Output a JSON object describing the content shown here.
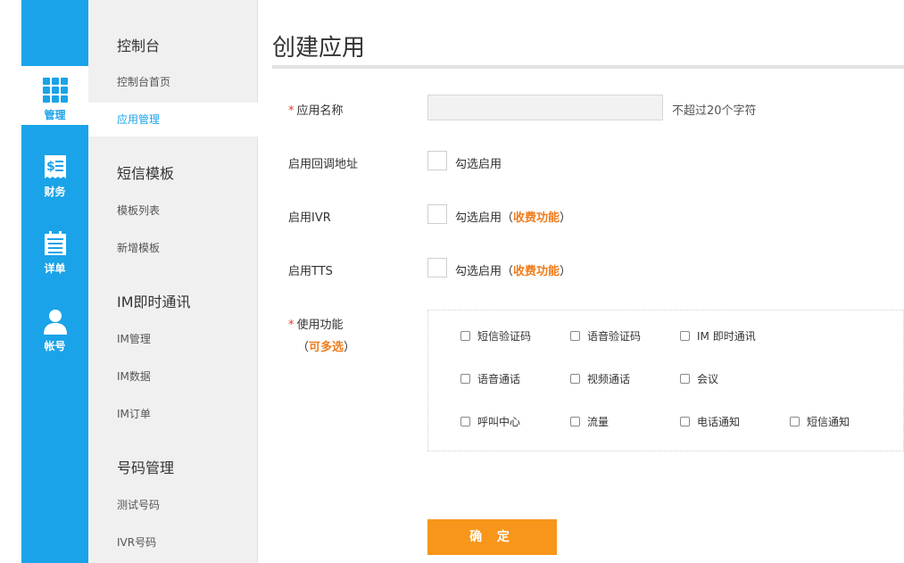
{
  "rail": {
    "items": [
      {
        "label": "管理",
        "icon": "grid-icon"
      },
      {
        "label": "财务",
        "icon": "invoice-icon"
      },
      {
        "label": "详单",
        "icon": "calendar-list-icon"
      },
      {
        "label": "帐号",
        "icon": "user-icon"
      }
    ]
  },
  "menu": {
    "groups": [
      {
        "title": "控制台",
        "items": [
          "控制台首页",
          "应用管理"
        ]
      },
      {
        "title": "短信模板",
        "items": [
          "模板列表",
          "新增模板"
        ]
      },
      {
        "title": "IM即时通讯",
        "items": [
          "IM管理",
          "IM数据",
          "IM订单"
        ]
      },
      {
        "title": "号码管理",
        "items": [
          "测试号码",
          "IVR号码"
        ]
      }
    ],
    "active_item": "应用管理"
  },
  "form": {
    "title": "创建应用",
    "required_mark": "*",
    "app_name": {
      "label": "应用名称",
      "value": "",
      "hint": "不超过20个字符"
    },
    "callback": {
      "label": "启用回调地址",
      "option": "勾选启用"
    },
    "ivr": {
      "label": "启用IVR",
      "option": "勾选启用",
      "paren_open": "（",
      "paid": "收费功能",
      "paren_close": "）"
    },
    "tts": {
      "label": "启用TTS",
      "option": "勾选启用",
      "paren_open": "（",
      "paid": "收费功能",
      "paren_close": "）"
    },
    "features": {
      "label": "使用功能",
      "hint_open": "（",
      "hint": "可多选",
      "hint_close": "）",
      "options": [
        "短信验证码",
        "语音验证码",
        "IM 即时通讯",
        "语音通话",
        "视频通话",
        "会议",
        "呼叫中心",
        "流量",
        "电话通知",
        "短信通知"
      ]
    },
    "submit_label": "确 定"
  },
  "colors": {
    "accent": "#1aa3e8",
    "button": "#f7961b",
    "paid": "#f07d1c",
    "required": "#e8382a"
  }
}
